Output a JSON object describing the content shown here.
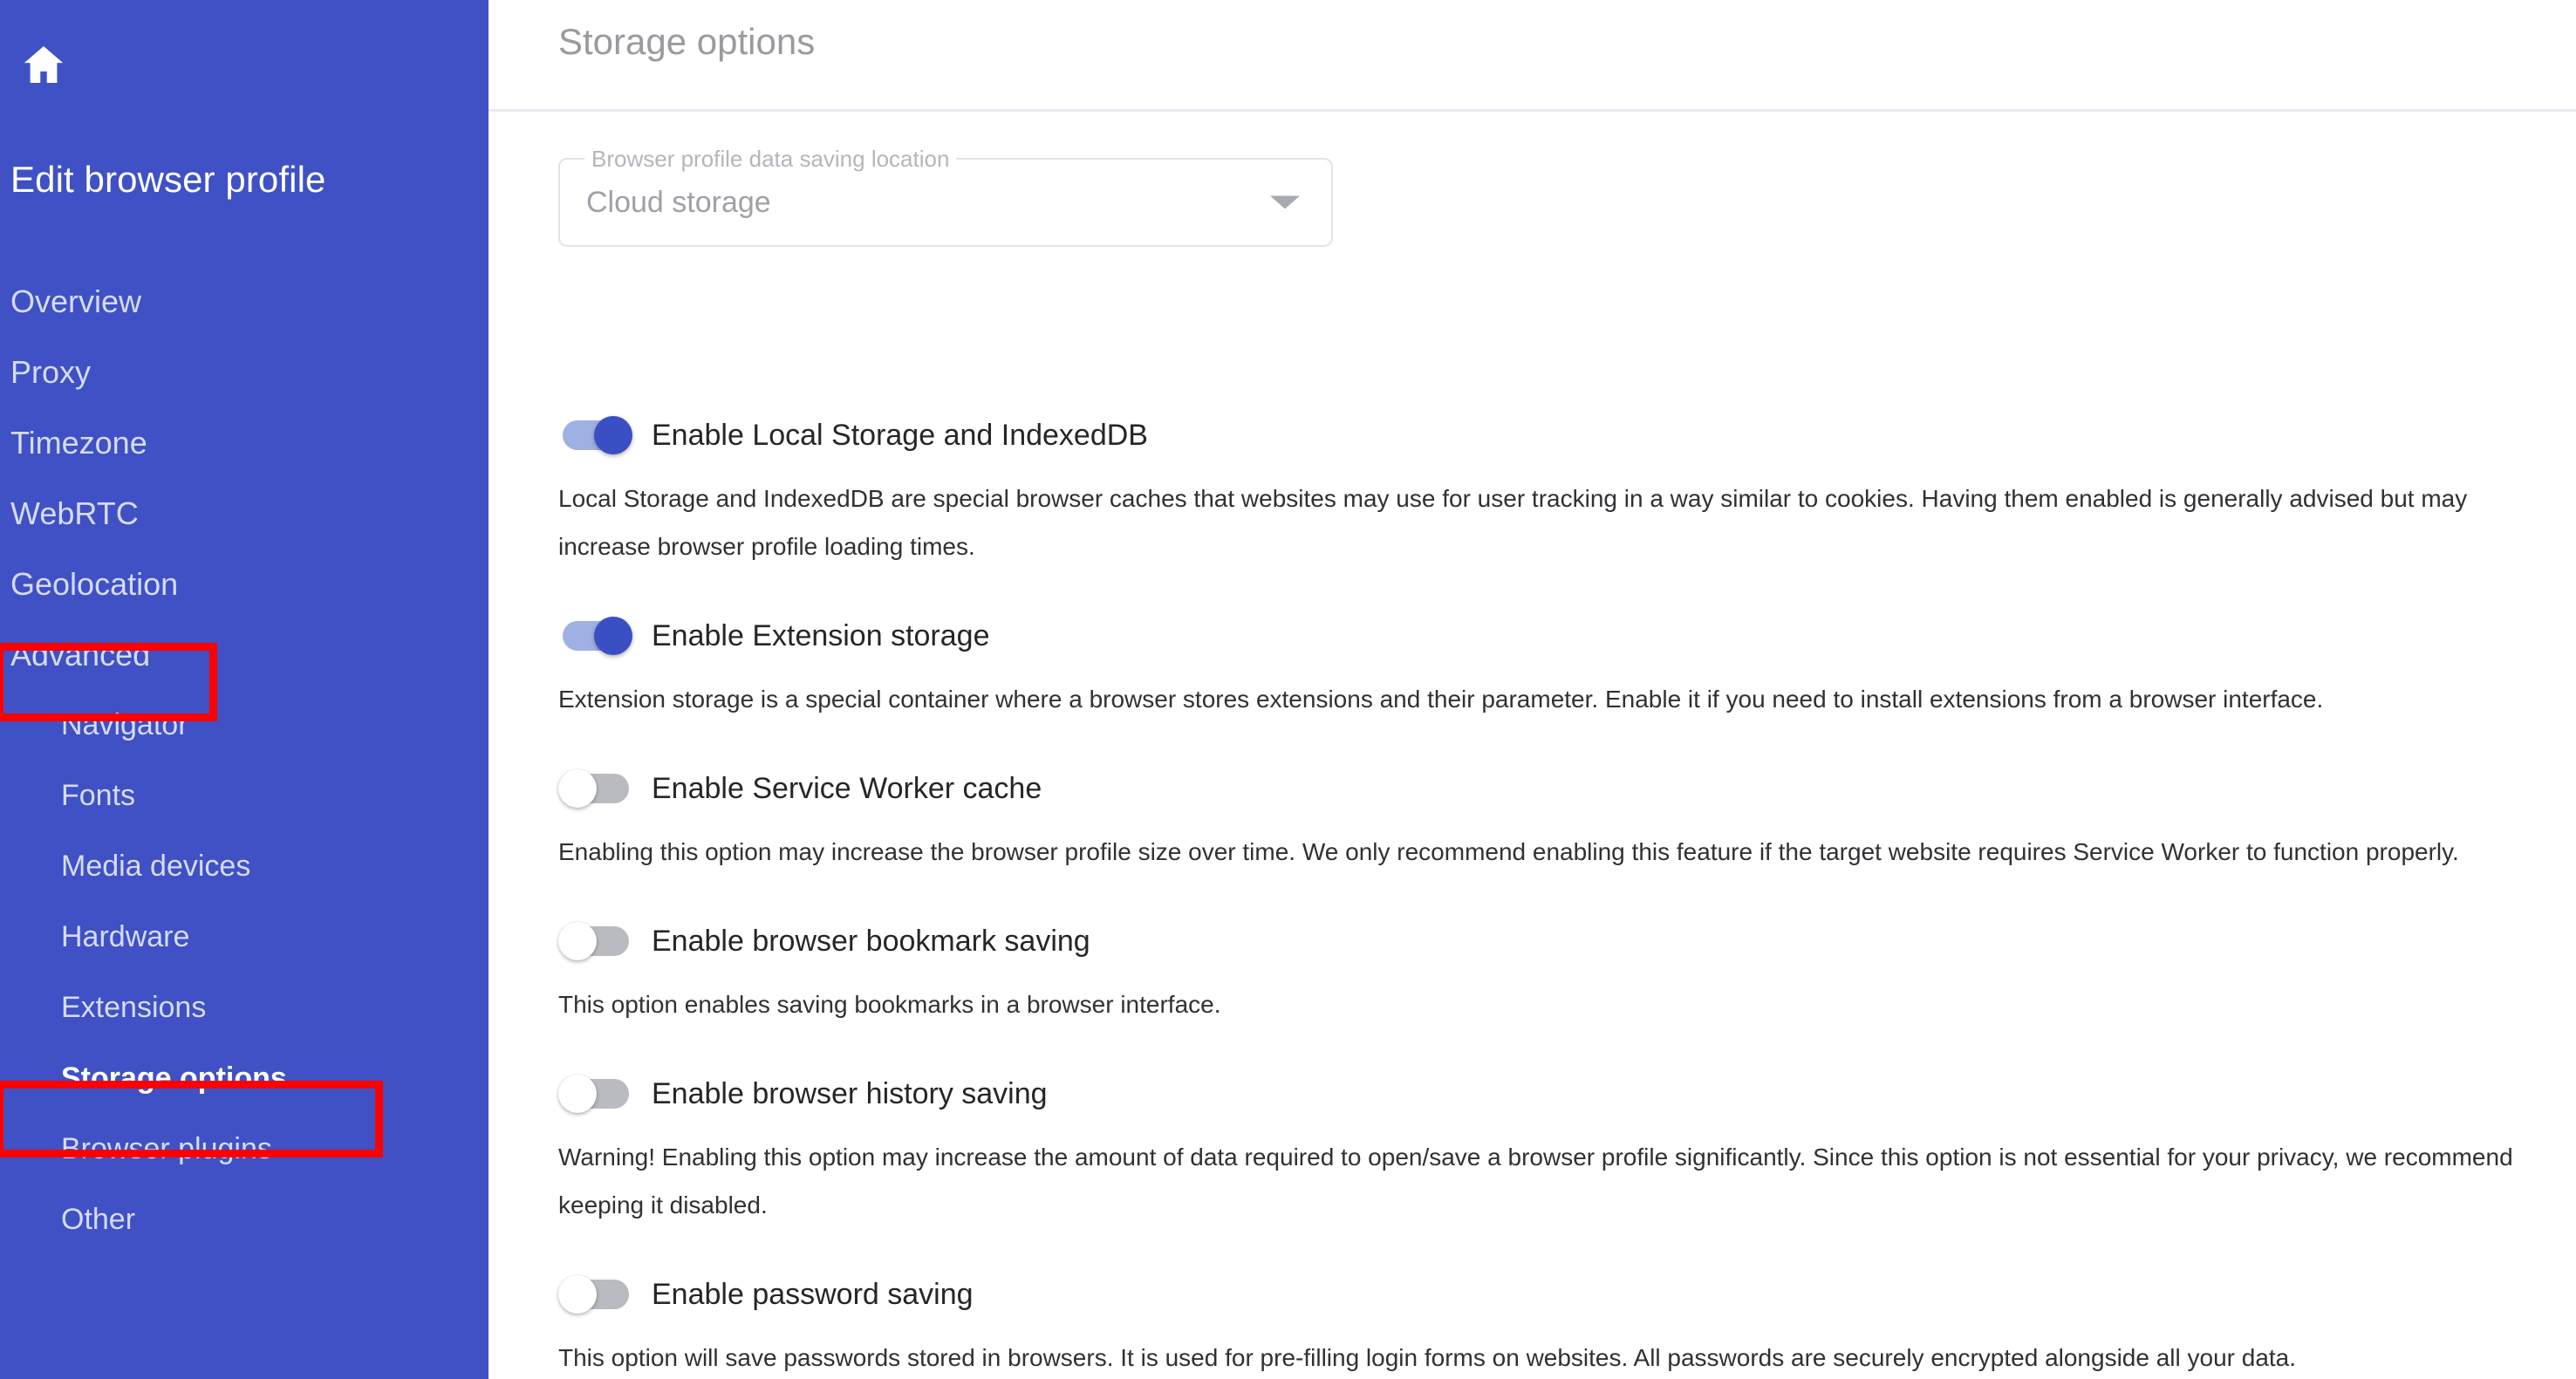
{
  "sidebar": {
    "home_icon": "home-icon",
    "title": "Edit browser profile",
    "items": [
      {
        "label": "Overview",
        "level": "top",
        "active": false
      },
      {
        "label": "Proxy",
        "level": "top",
        "active": false
      },
      {
        "label": "Timezone",
        "level": "top",
        "active": false
      },
      {
        "label": "WebRTC",
        "level": "top",
        "active": false
      },
      {
        "label": "Geolocation",
        "level": "top",
        "active": false
      },
      {
        "label": "Advanced",
        "level": "top",
        "active": false
      },
      {
        "label": "Navigator",
        "level": "sub",
        "active": false
      },
      {
        "label": "Fonts",
        "level": "sub",
        "active": false
      },
      {
        "label": "Media devices",
        "level": "sub",
        "active": false
      },
      {
        "label": "Hardware",
        "level": "sub",
        "active": false
      },
      {
        "label": "Extensions",
        "level": "sub",
        "active": false
      },
      {
        "label": "Storage options",
        "level": "sub",
        "active": true
      },
      {
        "label": "Browser plugins",
        "level": "sub",
        "active": false
      },
      {
        "label": "Other",
        "level": "sub",
        "active": false
      }
    ]
  },
  "header": {
    "title": "Storage options"
  },
  "storage_location": {
    "label": "Browser profile data saving location",
    "value": "Cloud storage",
    "arrow_icon": "chevron-down-icon"
  },
  "options": [
    {
      "label": "Enable Local Storage and IndexedDB",
      "enabled": true,
      "description": "Local Storage and IndexedDB are special browser caches that websites may use for user tracking in a way similar to cookies. Having them enabled is generally advised but may increase browser profile loading times."
    },
    {
      "label": "Enable Extension storage",
      "enabled": true,
      "description": "Extension storage is a special container where a browser stores extensions and their parameter. Enable it if you need to install extensions from a browser interface."
    },
    {
      "label": "Enable Service Worker cache",
      "enabled": false,
      "description": "Enabling this option may increase the browser profile size over time. We only recommend enabling this feature if the target website requires Service Worker to function properly."
    },
    {
      "label": "Enable browser bookmark saving",
      "enabled": false,
      "description": "This option enables saving bookmarks in a browser interface."
    },
    {
      "label": "Enable browser history saving",
      "enabled": false,
      "description": "Warning! Enabling this option may increase the amount of data required to open/save a browser profile significantly. Since this option is not essential for your privacy, we recommend keeping it disabled."
    },
    {
      "label": "Enable password saving",
      "enabled": false,
      "description": "This option will save passwords stored in browsers. It is used for pre-filling login forms on websites. All passwords are securely encrypted alongside all your data."
    }
  ],
  "annotations": {
    "highlight_color": "#fe0000",
    "highlighted_items": [
      "Advanced",
      "Storage options"
    ]
  },
  "colors": {
    "sidebar_background": "#3f51c4",
    "toggle_on_track": "#9fb0e3",
    "toggle_on_thumb": "#3b4fc4",
    "toggle_off_track": "#b9bbc0"
  }
}
